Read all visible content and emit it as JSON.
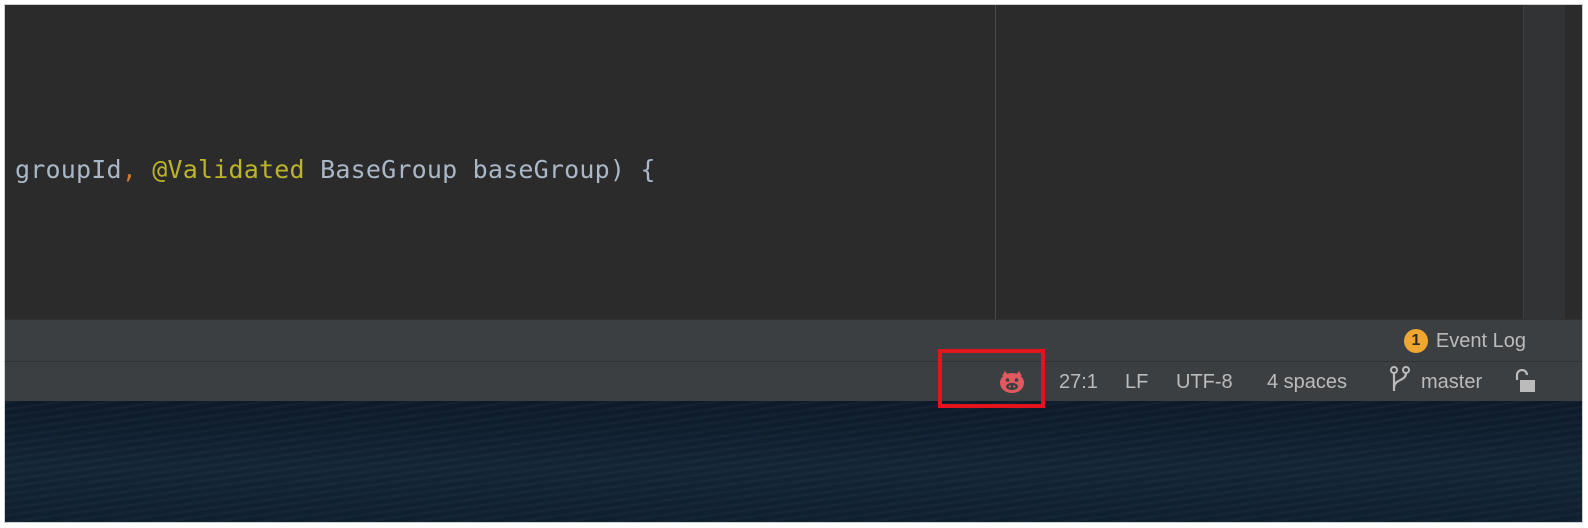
{
  "editor": {
    "code": {
      "tok1": "groupId",
      "tok2": ",",
      "tok3": " ",
      "tok4": "@Validated",
      "tok5": " BaseGroup baseGroup) {"
    }
  },
  "toolwindow_bar": {
    "event_log": {
      "badge_count": "1",
      "label": "Event Log"
    }
  },
  "status_bar": {
    "plugin_icon": "pig-face-icon",
    "caret_position": "27:1",
    "line_separator": "LF",
    "encoding": "UTF-8",
    "indent": "4 spaces",
    "vcs_icon": "git-branch-icon",
    "branch": "master",
    "lock_icon": "unlocked-padlock-icon"
  },
  "annotation": {
    "highlight_color": "#e3141b"
  },
  "colors": {
    "editor_bg": "#2b2b2b",
    "code_text": "#a9b7c6",
    "keyword_punct": "#cc7832",
    "annotation": "#bbb529",
    "status_text": "#bbbbbb",
    "badge": "#f0a732",
    "plugin_icon": "#e0595f"
  }
}
